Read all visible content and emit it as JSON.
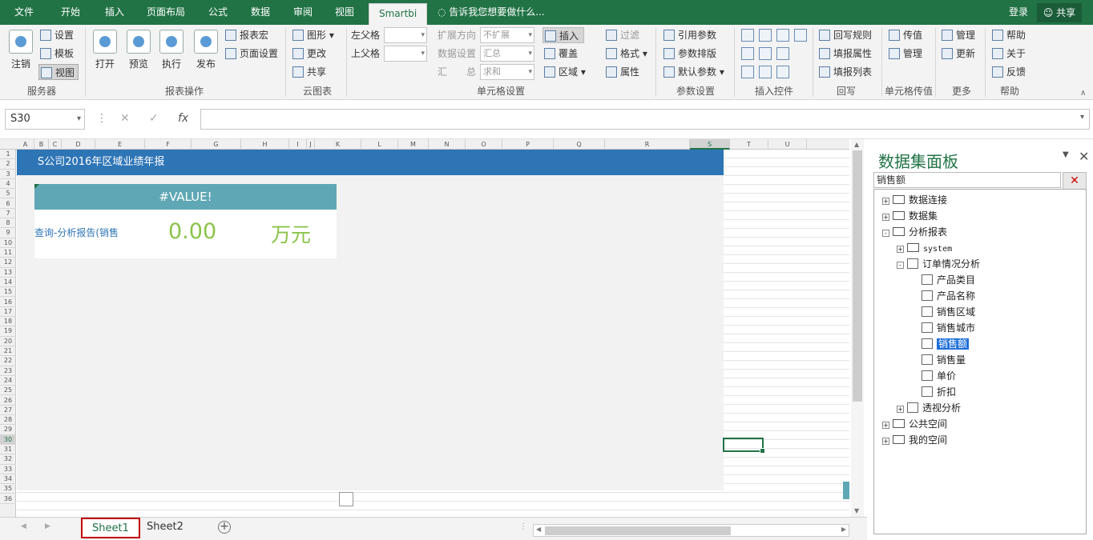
{
  "ribbon_tabs": [
    "文件",
    "开始",
    "插入",
    "页面布局",
    "公式",
    "数据",
    "审阅",
    "视图",
    "Smartbi"
  ],
  "active_tab": "Smartbi",
  "tell_me": "告诉我您想要做什么...",
  "login": "登录",
  "share": "共享",
  "groups": {
    "server": {
      "label": "服务器",
      "logout": "注销",
      "settings": "设置",
      "template": "模板",
      "view": "视图"
    },
    "report_ops": {
      "label": "报表操作",
      "open": "打开",
      "preview": "预览",
      "execute": "执行",
      "publish": "发布",
      "report_macro": "报表宏",
      "page_setup": "页面设置"
    },
    "cloud_chart": {
      "label": "云图表",
      "chart": "图形",
      "change": "更改",
      "share": "共享"
    },
    "cell_settings": {
      "label": "单元格设置",
      "left_parent": "左父格",
      "up_parent": "上父格",
      "expand_dir": "扩展方向",
      "expand_dir_value": "不扩展",
      "data_setting": "数据设置",
      "data_setting_value": "汇总",
      "aggregate": "汇　　总",
      "aggregate_value": "求和",
      "insert": "插入",
      "cover": "覆盖",
      "region": "区域",
      "filter": "过滤",
      "format": "格式",
      "property": "属性"
    },
    "param_settings": {
      "label": "参数设置",
      "ref_param": "引用参数",
      "param_layout": "参数排版",
      "default_param": "默认参数"
    },
    "insert_control": {
      "label": "插入控件"
    },
    "writeback": {
      "label": "回写",
      "rules": "回写规则",
      "fill_props": "填报属性",
      "fill_list": "填报列表"
    },
    "cell_pass": {
      "label": "单元格传值",
      "pass": "传值",
      "manage": "管理"
    },
    "more": {
      "label": "更多",
      "manage": "管理",
      "update": "更新"
    },
    "help": {
      "label": "帮助",
      "help": "帮助",
      "about": "关于",
      "feedback": "反馈"
    }
  },
  "name_box": "S30",
  "formula": "",
  "columns": [
    "A",
    "B",
    "C",
    "D",
    "E",
    "F",
    "G",
    "H",
    "I",
    "J",
    "K",
    "L",
    "M",
    "N",
    "O",
    "P",
    "Q",
    "R",
    "S",
    "T",
    "U"
  ],
  "rows": [
    "1",
    "2",
    "3",
    "4",
    "5",
    "6",
    "7",
    "8",
    "9",
    "10",
    "11",
    "12",
    "13",
    "14",
    "15",
    "16",
    "17",
    "18",
    "19",
    "20",
    "21",
    "22",
    "23",
    "24",
    "25",
    "26",
    "27",
    "28",
    "29",
    "30",
    "31",
    "32",
    "33",
    "34",
    "35",
    "36"
  ],
  "selected_column": "S",
  "selected_row": "30",
  "report": {
    "banner_title": "S公司2016年区域业绩年报",
    "card_header": "#VALUE!",
    "query_text": "查询-分析报告(销售",
    "value": "0.00",
    "unit": "万元"
  },
  "sheets": [
    "Sheet1",
    "Sheet2"
  ],
  "active_sheet": "Sheet1",
  "panel": {
    "title": "数据集面板",
    "search_value": "销售额",
    "tree": [
      {
        "label": "数据连接",
        "level": 0,
        "icon": "folder",
        "expander": "+"
      },
      {
        "label": "数据集",
        "level": 0,
        "icon": "folder",
        "expander": "+"
      },
      {
        "label": "分析报表",
        "level": 0,
        "icon": "folder",
        "expander": "-"
      },
      {
        "label": "system",
        "level": 1,
        "icon": "folder",
        "expander": "+"
      },
      {
        "label": "订单情况分析",
        "level": 1,
        "icon": "report",
        "expander": "-"
      },
      {
        "label": "产品类目",
        "level": 2,
        "icon": "field",
        "expander": ""
      },
      {
        "label": "产品名称",
        "level": 2,
        "icon": "field",
        "expander": ""
      },
      {
        "label": "销售区域",
        "level": 2,
        "icon": "field",
        "expander": ""
      },
      {
        "label": "销售城市",
        "level": 2,
        "icon": "field",
        "expander": ""
      },
      {
        "label": "销售额",
        "level": 2,
        "icon": "field",
        "expander": "",
        "selected": true
      },
      {
        "label": "销售量",
        "level": 2,
        "icon": "field",
        "expander": ""
      },
      {
        "label": "单价",
        "level": 2,
        "icon": "field",
        "expander": ""
      },
      {
        "label": "折扣",
        "level": 2,
        "icon": "field",
        "expander": ""
      },
      {
        "label": "透视分析",
        "level": 1,
        "icon": "report",
        "expander": "+"
      },
      {
        "label": "公共空间",
        "level": 0,
        "icon": "folder",
        "expander": "+"
      },
      {
        "label": "我的空间",
        "level": 0,
        "icon": "user-folder",
        "expander": "+"
      }
    ]
  }
}
